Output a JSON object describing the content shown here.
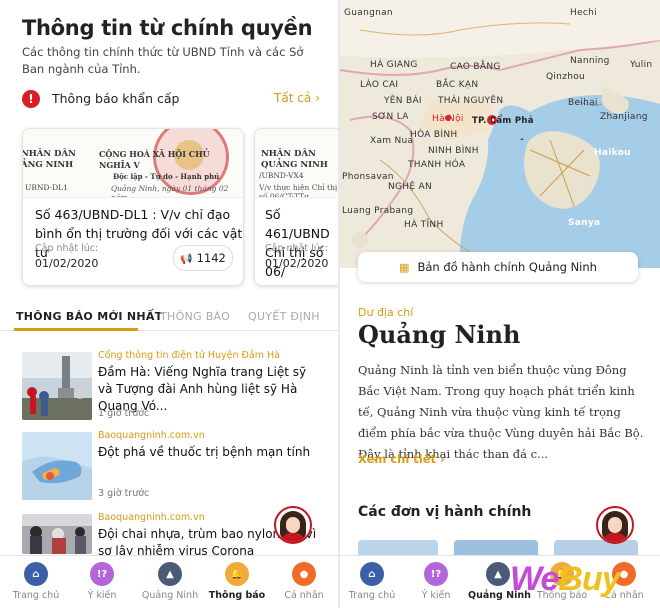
{
  "left": {
    "title": "Thông tin từ chính quyền",
    "description": "Các thông tin chính thức từ UBND Tỉnh và các Sở Ban ngành của Tỉnh.",
    "urgent": {
      "icon": "alert-icon",
      "label": "Thông báo khẩn cấp",
      "all_link": "Tất cả"
    },
    "cards": [
      {
        "doc_left": [
          "NHÂN DÂN",
          "ẢNG NINH"
        ],
        "doc_right": [
          "CỘNG HOÀ XÃ HỘI CHỦ NGHĨA V",
          "Độc lập - Tự do - Hạnh phú"
        ],
        "doc_code": "UBND-DL1",
        "doc_sub": "Quảng Ninh, ngày 01 tháng 02 năm",
        "title": "Số 463/UBND-DL1 : V/v chỉ đạo bình ổn thị trường đối với các vật tư",
        "updated_label": "Cập nhật lúc:",
        "date": "01/02/2020",
        "views": "1142"
      },
      {
        "doc_left": [
          "NHÂN DÂN",
          "QUẢNG NINH"
        ],
        "doc_code": "/UBND-VX4",
        "doc_sub": "V/v thực hiện Chỉ thị số 06/CT-TTg",
        "title": "Số 461/UBND Chỉ thị số 06/",
        "updated_label": "Cập nhật lúc:",
        "date": "01/02/2020"
      }
    ],
    "tabs": [
      "THÔNG BÁO MỚI NHẤT",
      "THÔNG BÁO",
      "QUYẾT ĐỊNH"
    ],
    "news": [
      {
        "source": "Cổng thông tin điện tử Huyện Đầm Hà",
        "title": "Đầm Hà: Viếng Nghĩa trang Liệt sỹ và Tượng đài Anh hùng liệt sỹ Hà Quang Vó...",
        "time": "1 giờ trước"
      },
      {
        "source": "Baoquangninh.com.vn",
        "title": "Đột phá về thuốc trị bệnh mạn tính",
        "time": "3 giờ trước"
      },
      {
        "source": "Baoquangninh.com.vn",
        "title": "Đội chai nhựa, trùm bao nylon kín vì sợ lây nhiễm virus Corona",
        "time": ""
      }
    ],
    "nav": [
      {
        "label": "Trang chủ",
        "icon": "home-icon",
        "color": "#3b5fa8"
      },
      {
        "label": "Ý kiến",
        "icon": "feedback-icon",
        "color": "#b266d9"
      },
      {
        "label": "Quảng Ninh",
        "icon": "landscape-icon",
        "color": "#4a5a78"
      },
      {
        "label": "Thông báo",
        "icon": "bell-icon",
        "color": "#f0a93a"
      },
      {
        "label": "Cá nhân",
        "icon": "person-icon",
        "color": "#f06b2a"
      }
    ],
    "active_nav": 3
  },
  "right": {
    "map_labels": {
      "places": [
        "Hechi",
        "Nanning",
        "Yulin",
        "Beihai",
        "Zhanjiang",
        "Haikou",
        "Sanya",
        "Qinzhou",
        "HÀ GIANG",
        "CAO BẰNG",
        "LÀO CAI",
        "BẮC KẠN",
        "YÊN BÁI",
        "THÁI NGUYÊN",
        "SƠN LA",
        "Hà Nội",
        "TP. Cẩm Phả",
        "HÒA BÌNH",
        "NINH BÌNH",
        "THANH HÓA",
        "Xam Nua",
        "NGHỆ AN",
        "HÀ TĨNH",
        "Phonsavan",
        "Luang Prabang"
      ]
    },
    "map_button": {
      "icon": "map-icon",
      "label": "Bản đồ hành chính Quảng Ninh"
    },
    "kicker": "Dư địa chí",
    "title": "Quảng Ninh",
    "body": "Quảng Ninh là tỉnh ven biển thuộc vùng Đông Bắc Việt Nam. Trong quy hoạch phát triển kinh tế, Quảng Ninh vừa thuộc vùng kinh tế trọng điểm phía bắc vừa thuộc Vùng duyên hải Bắc Bộ. Đây là tỉnh khai thác than đá c...",
    "more_link": "Xem chi tiết",
    "section": "Các đơn vị hành chính",
    "nav": [
      {
        "label": "Trang chủ",
        "icon": "home-icon",
        "color": "#3b5fa8"
      },
      {
        "label": "Ý kiến",
        "icon": "feedback-icon",
        "color": "#b266d9"
      },
      {
        "label": "Quảng Ninh",
        "icon": "landscape-icon",
        "color": "#4a5a78"
      },
      {
        "label": "Thông báo",
        "icon": "bell-icon",
        "color": "#f0a93a"
      },
      {
        "label": "Cá nhân",
        "icon": "person-icon",
        "color": "#f06b2a"
      }
    ],
    "active_nav": 2
  },
  "watermark": {
    "we": "We",
    "buy": "Buy"
  }
}
